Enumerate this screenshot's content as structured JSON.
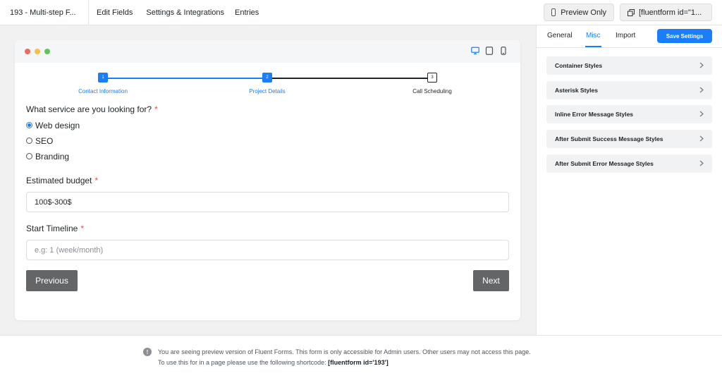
{
  "header": {
    "form_title": "193 - Multi-step F...",
    "nav": [
      "Edit Fields",
      "Settings & Integrations",
      "Entries"
    ],
    "preview_only": "Preview Only",
    "shortcode_button": "[fluentform id=\"1..."
  },
  "preview": {
    "window_dots": [
      "#ed6a5e",
      "#f4bf4f",
      "#61c554"
    ],
    "device_icons": [
      "desktop-icon",
      "tablet-icon",
      "mobile-icon"
    ],
    "steps": [
      {
        "number": "1",
        "label": "Contact Information",
        "state": "done"
      },
      {
        "number": "2",
        "label": "Project Details",
        "state": "active"
      },
      {
        "number": "3",
        "label": "Call Scheduling",
        "state": "pending"
      }
    ],
    "service_question": "What service are you looking for?",
    "required_mark": "*",
    "service_options": [
      {
        "label": "Web design",
        "checked": true
      },
      {
        "label": "SEO",
        "checked": false
      },
      {
        "label": "Branding",
        "checked": false
      }
    ],
    "budget_label": "Estimated budget",
    "budget_value": "100$-300$",
    "timeline_label": "Start Timeline",
    "timeline_placeholder": "e.g: 1 (week/month)",
    "previous_button": "Previous",
    "next_button": "Next"
  },
  "footer": {
    "notice_line1": "You are seeing preview version of Fluent Forms. This form is only accessible for Admin users. Other users may not access this page.",
    "notice_line2_prefix": "To use this for in a page please use the following shortcode:",
    "shortcode": "[fluentform id='193']"
  },
  "settings": {
    "tabs": [
      "General",
      "Misc",
      "Import"
    ],
    "active_tab": "Misc",
    "save_button": "Save Settings",
    "sections": [
      "Container Styles",
      "Asterisk Styles",
      "Inline Error Message Styles",
      "After Submit Success Message Styles",
      "After Submit Error Message Styles"
    ]
  },
  "colors": {
    "accent": "#1a7efb",
    "required": "#e54b4b",
    "dark_button": "#646566"
  }
}
